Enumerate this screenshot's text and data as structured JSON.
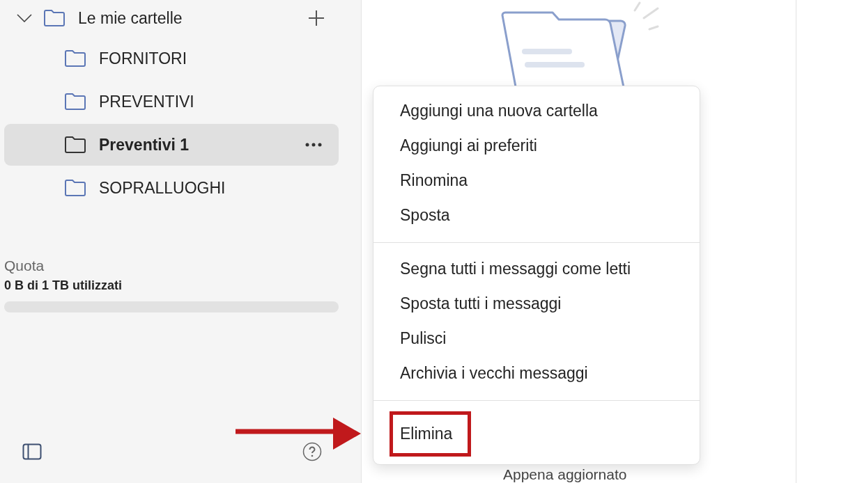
{
  "sidebar": {
    "section": {
      "label": "Le mie cartelle",
      "expanded": true,
      "children": [
        {
          "label": "FORNITORI",
          "selected": false
        },
        {
          "label": "PREVENTIVI",
          "selected": false
        },
        {
          "label": "Preventivi 1",
          "selected": true
        },
        {
          "label": "SOPRALLUOGHI",
          "selected": false
        }
      ]
    },
    "quota": {
      "label": "Quota",
      "usage": "0 B di 1 TB utilizzati",
      "level": 0
    }
  },
  "main": {
    "status": "Appena aggiornato"
  },
  "context_menu": {
    "groups": [
      [
        {
          "label": "Aggiungi una nuova cartella",
          "highlighted": false
        },
        {
          "label": "Aggiungi ai preferiti",
          "highlighted": false
        },
        {
          "label": "Rinomina",
          "highlighted": false
        },
        {
          "label": "Sposta",
          "highlighted": false
        }
      ],
      [
        {
          "label": "Segna tutti i messaggi come letti",
          "highlighted": false
        },
        {
          "label": "Sposta tutti i messaggi",
          "highlighted": false
        },
        {
          "label": "Pulisci",
          "highlighted": false
        },
        {
          "label": "Archivia i vecchi messaggi",
          "highlighted": false
        }
      ],
      [
        {
          "label": "Elimina",
          "highlighted": true
        }
      ]
    ]
  }
}
